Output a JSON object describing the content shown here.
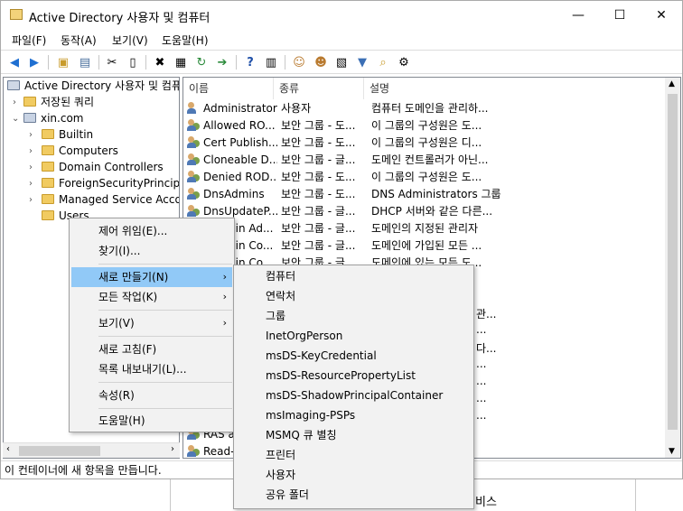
{
  "window": {
    "title": "Active Directory 사용자 및 컴퓨터",
    "minimize": "—",
    "maximize": "☐",
    "close": "✕"
  },
  "menubar": [
    "파일(F)",
    "동작(A)",
    "보기(V)",
    "도움말(H)"
  ],
  "tree": {
    "root": "Active Directory 사용자 및 컴퓨",
    "saved_queries": "저장된 쿼리",
    "domain": "xin.com",
    "children": [
      "Builtin",
      "Computers",
      "Domain Controllers",
      "ForeignSecurityPrincipal",
      "Managed Service Accou",
      "Users"
    ]
  },
  "list": {
    "columns": [
      "이름",
      "종류",
      "설명"
    ],
    "rows": [
      [
        "Administrator",
        "사용자",
        "컴퓨터 도메인을 관리하..."
      ],
      [
        "Allowed RO...",
        "보안 그룹 - 도...",
        "이 그룹의 구성원은 도..."
      ],
      [
        "Cert Publish...",
        "보안 그룹 - 도...",
        "이 그룹의 구성원은 디..."
      ],
      [
        "Cloneable D...",
        "보안 그룹 - 글...",
        "도메인 컨트롤러가 아닌..."
      ],
      [
        "Denied ROD...",
        "보안 그룹 - 도...",
        "이 그룹의 구성원은 도..."
      ],
      [
        "DnsAdmins",
        "보안 그룹 - 도...",
        "DNS Administrators 그룹"
      ],
      [
        "DnsUpdateP...",
        "보안 그룹 - 글...",
        "DHCP 서버와 같은 다른..."
      ],
      [
        "Domain Ad...",
        "보안 그룹 - 글...",
        "도메인의 지정된 관리자"
      ],
      [
        "Domain Co...",
        "보안 그룹 - 글...",
        "도메인에 가입된 모든 ..."
      ],
      [
        "Domain Co...",
        "보안 그룹 - 글...",
        "도메인에 있는 모든 도..."
      ]
    ],
    "partial": [
      "관...",
      "...",
      "다...",
      "...",
      "...",
      "...",
      "..."
    ],
    "bottom_rows": [
      "RAS a",
      "Read-c"
    ]
  },
  "context_menu": [
    "제어 위임(E)...",
    "찾기(I)...",
    "새로 만들기(N)",
    "모든 작업(K)",
    "보기(V)",
    "새로 고침(F)",
    "목록 내보내기(L)...",
    "속성(R)",
    "도움말(H)"
  ],
  "submenu": [
    "컴퓨터",
    "연락처",
    "그룹",
    "InetOrgPerson",
    "msDS-KeyCredential",
    "msDS-ResourcePropertyList",
    "msDS-ShadowPrincipalContainer",
    "msImaging-PSPs",
    "MSMQ 큐 별칭",
    "프린터",
    "사용자",
    "공유 폴더"
  ],
  "status": "이 컨테이너에 새 항목을 만듭니다.",
  "behind_text": "비스"
}
